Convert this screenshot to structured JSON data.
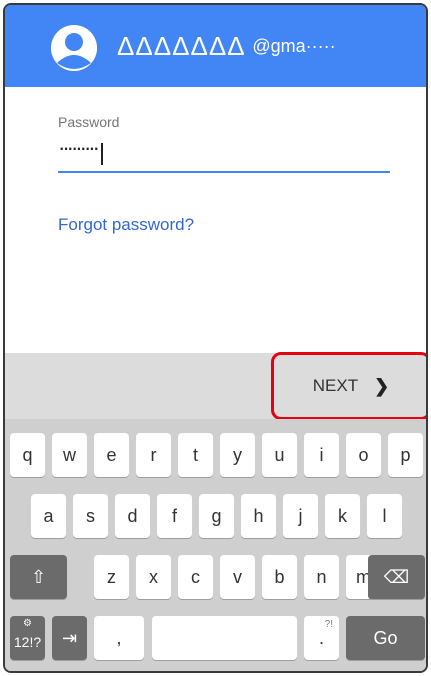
{
  "header": {
    "account_name": "ΔΔΔΔΔΔΔ",
    "account_suffix": "@gma·····",
    "bar_color": "#4285f4",
    "avatar_icon": "person-icon"
  },
  "form": {
    "password_label": "Password",
    "password_value": "·········",
    "forgot_link": "Forgot password?"
  },
  "actions": {
    "next_label": "NEXT",
    "next_chevron": "❯",
    "highlight_color": "#e60012"
  },
  "keyboard": {
    "row1": [
      "q",
      "w",
      "e",
      "r",
      "t",
      "y",
      "u",
      "i",
      "o",
      "p"
    ],
    "row2": [
      "a",
      "s",
      "d",
      "f",
      "g",
      "h",
      "j",
      "k",
      "l"
    ],
    "row3": [
      "z",
      "x",
      "c",
      "v",
      "b",
      "n",
      "m"
    ],
    "shift": "⇧",
    "backspace": "⌫",
    "symbols": "12!?",
    "symbols_gear": "⚙",
    "tab": "⇥",
    "comma": ",",
    "period": ".",
    "period_hint": "?!",
    "go": "Go"
  }
}
